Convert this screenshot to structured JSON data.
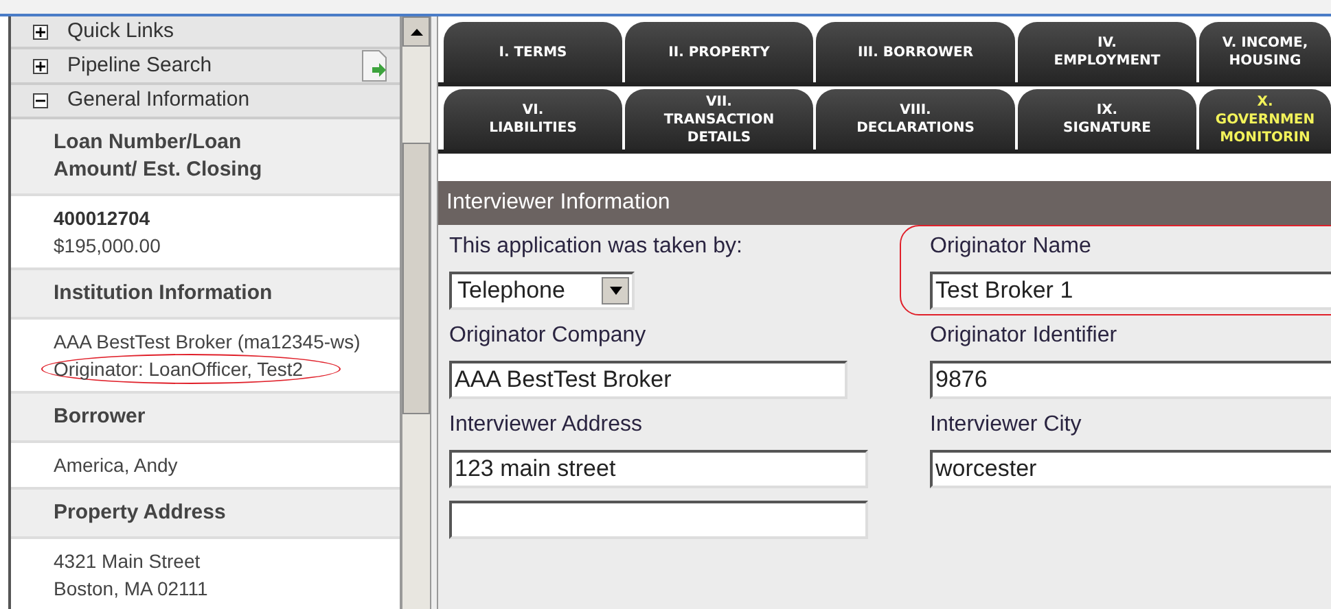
{
  "sidebar": {
    "nav": [
      {
        "label": "Quick Links",
        "expanded": false,
        "action_icon": false
      },
      {
        "label": "Pipeline Search",
        "expanded": false,
        "action_icon": true
      },
      {
        "label": "General Information",
        "expanded": true,
        "action_icon": false
      }
    ],
    "sections": [
      {
        "heading": "Loan Number/Loan Amount/ Est. Closing",
        "lines": [
          {
            "text": "400012704",
            "bold": true,
            "circled": false
          },
          {
            "text": "$195,000.00",
            "bold": false,
            "circled": false
          }
        ]
      },
      {
        "heading": "Institution Information",
        "lines": [
          {
            "text": "AAA BestTest Broker (ma12345-ws)",
            "bold": false,
            "circled": false
          },
          {
            "text": "Originator: LoanOfficer, Test2",
            "bold": false,
            "circled": true
          }
        ]
      },
      {
        "heading": "Borrower",
        "lines": [
          {
            "text": "America, Andy",
            "bold": false,
            "circled": false
          }
        ]
      },
      {
        "heading": "Property Address",
        "lines": [
          {
            "text": "4321 Main Street",
            "bold": false,
            "circled": false
          },
          {
            "text": "Boston, MA 02111",
            "bold": false,
            "circled": false
          }
        ]
      }
    ]
  },
  "tabs": [
    [
      {
        "lines": [
          "I. TERMS"
        ],
        "selected": false
      },
      {
        "lines": [
          "II. PROPERTY"
        ],
        "selected": false
      },
      {
        "lines": [
          "III. BORROWER"
        ],
        "selected": false
      },
      {
        "lines": [
          "IV.",
          "EMPLOYMENT"
        ],
        "selected": false
      },
      {
        "lines": [
          "V. INCOME,",
          "HOUSING"
        ],
        "selected": false
      }
    ],
    [
      {
        "lines": [
          "VI.",
          "LIABILITIES"
        ],
        "selected": false
      },
      {
        "lines": [
          "VII.",
          "TRANSACTION",
          "DETAILS"
        ],
        "selected": false
      },
      {
        "lines": [
          "VIII.",
          "DECLARATIONS"
        ],
        "selected": false
      },
      {
        "lines": [
          "IX.",
          "SIGNATURE"
        ],
        "selected": false
      },
      {
        "lines": [
          "X.",
          "GOVERNMEN",
          "MONITORIN"
        ],
        "selected": true
      }
    ]
  ],
  "form": {
    "title": "Interviewer Information",
    "rows": [
      [
        {
          "label": "This application was taken by:",
          "kind": "select",
          "value": "Telephone",
          "circled": false
        },
        {
          "label": "Originator Name",
          "kind": "input",
          "value": "Test Broker 1",
          "circled": true
        }
      ],
      [
        {
          "label": "Originator Company",
          "kind": "input",
          "value": "AAA BestTest Broker",
          "circled": false
        },
        {
          "label": "Originator Identifier",
          "kind": "input",
          "value": "9876",
          "circled": false
        }
      ],
      [
        {
          "label": "Interviewer Address",
          "kind": "input",
          "value": "123 main street",
          "circled": false
        },
        {
          "label": "Interviewer City",
          "kind": "input",
          "value": "worcester",
          "circled": false
        }
      ],
      [
        {
          "kind": "input",
          "circled": false
        }
      ]
    ]
  }
}
